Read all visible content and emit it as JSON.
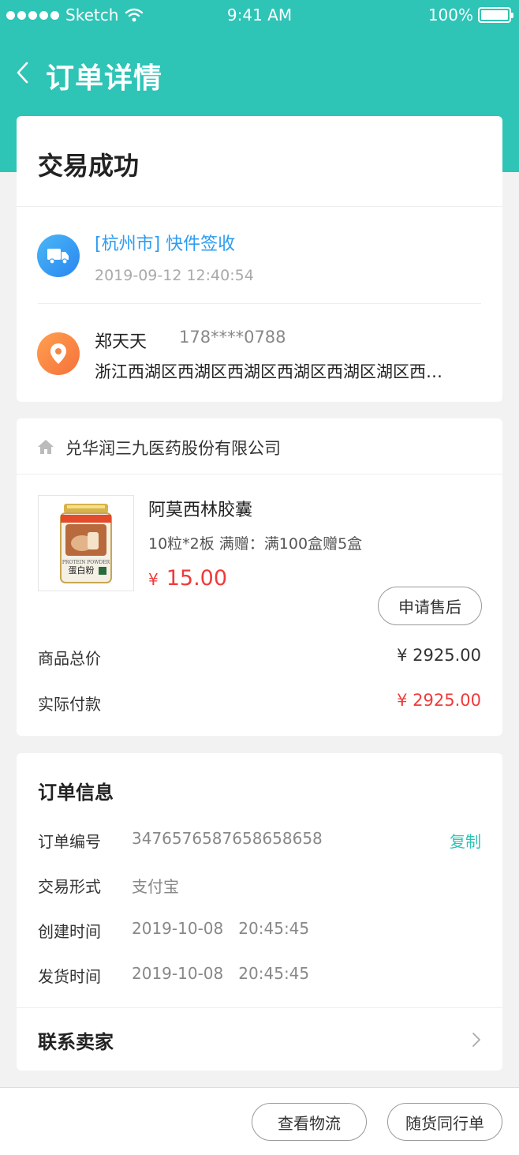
{
  "status_bar": {
    "carrier": "Sketch",
    "time": "9:41 AM",
    "battery": "100%"
  },
  "nav": {
    "title": "订单详情"
  },
  "order_status": {
    "title": "交易成功"
  },
  "logistics": {
    "latest": "[杭州市] 快件签收",
    "time": "2019-09-12 12:40:54"
  },
  "receiver": {
    "name": "郑天天",
    "phone": "178****0788",
    "address": "浙江西湖区西湖区西湖区西湖区西湖区湖区西湖区西湖区"
  },
  "store": {
    "name": "兑华润三九医药股份有限公司"
  },
  "product": {
    "name": "阿莫西林胶囊",
    "spec": "10粒*2板   满赠：满100盒赠5盒",
    "currency": "¥",
    "price": "15.00",
    "after_sale_label": "申请售后",
    "image_text": "蛋白粉",
    "image_text_en": "PROTEIN POWDER"
  },
  "totals": {
    "goods_total_label": "商品总价",
    "goods_total": "¥ 2925.00",
    "paid_label": "实际付款",
    "paid": "¥ 2925.00"
  },
  "order_info": {
    "title": "订单信息",
    "rows": [
      {
        "label": "订单编号",
        "value": "347657658765865865​8"
      },
      {
        "label": "交易形式",
        "value": "支付宝"
      },
      {
        "label": "创建时间",
        "value": "2019-10-08   20:45:45"
      },
      {
        "label": "发货时间",
        "value": "2019-10-08   20:45:45"
      }
    ],
    "copy_label": "复制",
    "contact_label": "联系卖家"
  },
  "bottom_bar": {
    "logistics_button": "查看物流",
    "waybill_button": "随货同行单"
  },
  "colors": {
    "brand": "#2ec4b6",
    "price": "#f03a3a",
    "link": "#2d9cf0"
  }
}
